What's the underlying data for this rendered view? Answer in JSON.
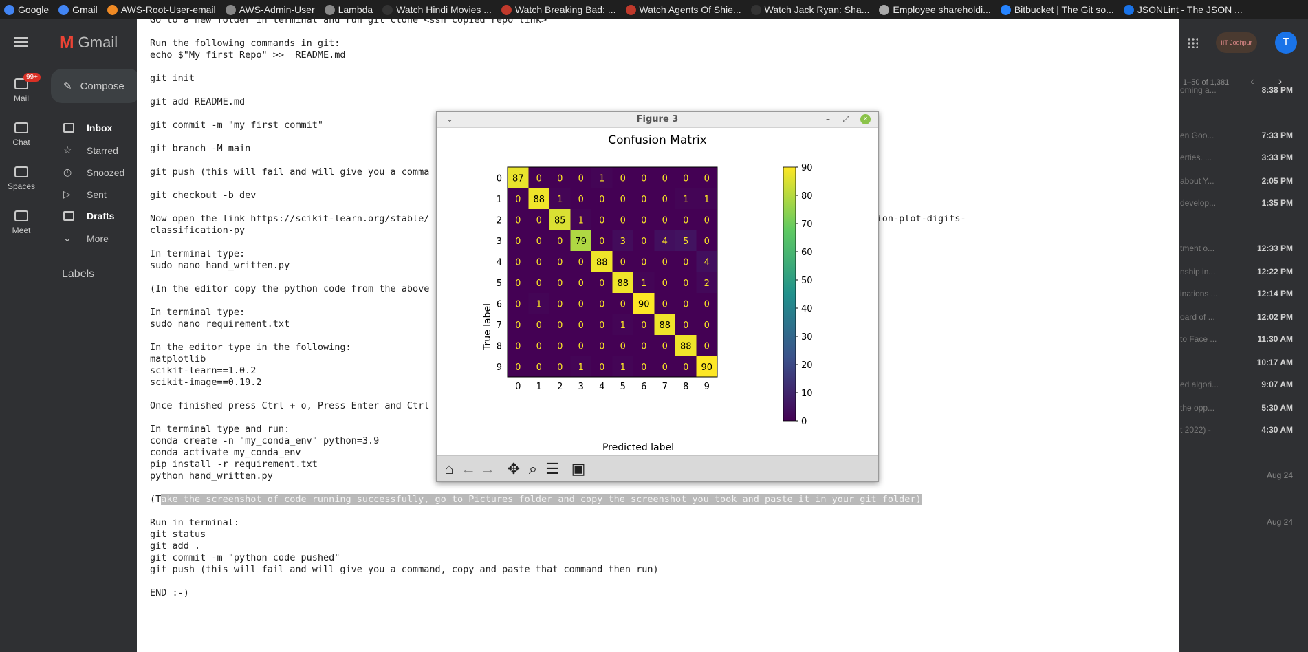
{
  "bookmarks": [
    {
      "label": "Google",
      "icon": "google-icon",
      "color": "#4285f4"
    },
    {
      "label": "Gmail",
      "icon": "google-icon",
      "color": "#4285f4"
    },
    {
      "label": "AWS-Root-User-email",
      "icon": "aws-icon",
      "color": "#f08a24"
    },
    {
      "label": "AWS-Admin-User",
      "icon": "globe-icon",
      "color": "#888888"
    },
    {
      "label": "Lambda",
      "icon": "folder-icon",
      "color": "#888888"
    },
    {
      "label": "Watch Hindi Movies ...",
      "icon": "site-icon",
      "color": "#333333"
    },
    {
      "label": "Watch Breaking Bad: ...",
      "icon": "site-icon",
      "color": "#c0392b"
    },
    {
      "label": "Watch Agents Of Shie...",
      "icon": "site-icon",
      "color": "#c0392b"
    },
    {
      "label": "Watch Jack Ryan: Sha...",
      "icon": "site-icon",
      "color": "#333333"
    },
    {
      "label": "Employee shareholdi...",
      "icon": "site-icon",
      "color": "#aaaaaa"
    },
    {
      "label": "Bitbucket | The Git so...",
      "icon": "bitbucket-icon",
      "color": "#2684ff"
    },
    {
      "label": "JSONLint - The JSON ...",
      "icon": "json-icon",
      "color": "#1a73e8"
    }
  ],
  "gmail": {
    "app_name": "Gmail",
    "compose": "Compose",
    "mail_badge": "99+",
    "rail": [
      "Mail",
      "Chat",
      "Spaces",
      "Meet"
    ],
    "nav": [
      "Inbox",
      "Starred",
      "Snoozed",
      "Sent",
      "Drafts",
      "More"
    ],
    "labels_heading": "Labels",
    "pager": "1–50 of 1,381",
    "avatar_letter": "T",
    "org_badge": "IIT Jodhpur",
    "rows": [
      {
        "snippet": "oming a...",
        "time": "8:38 PM",
        "bold": true
      },
      {
        "snippet": "en Goo...",
        "time": "7:33 PM",
        "bold": true
      },
      {
        "snippet": "erties. ...",
        "time": "3:33 PM",
        "bold": true
      },
      {
        "snippet": "about Y...",
        "time": "2:05 PM",
        "bold": true
      },
      {
        "snippet": "develop...",
        "time": "1:35 PM",
        "bold": true
      },
      {
        "snippet": "tment o...",
        "time": "12:33 PM",
        "bold": true
      },
      {
        "snippet": "nship in...",
        "time": "12:22 PM",
        "bold": true
      },
      {
        "snippet": "inations ...",
        "time": "12:14 PM",
        "bold": true
      },
      {
        "snippet": "oard of ...",
        "time": "12:02 PM",
        "bold": true
      },
      {
        "snippet": "to Face ...",
        "time": "11:30 AM",
        "bold": true
      },
      {
        "snippet": "",
        "time": "10:17 AM",
        "bold": true
      },
      {
        "snippet": "ed algori...",
        "time": "9:07 AM",
        "bold": true
      },
      {
        "snippet": "the opp...",
        "time": "5:30 AM",
        "bold": true
      },
      {
        "snippet": "t 2022) -",
        "time": "4:30 AM",
        "bold": true
      },
      {
        "snippet": "",
        "time": "Aug 24",
        "bold": false
      },
      {
        "snippet": "",
        "time": "Aug 24",
        "bold": false
      }
    ]
  },
  "document": {
    "lines_before": [
      "Go to a new folder in terminal and run git clone <ssh copied repo link>",
      "",
      "Run the following commands in git:",
      "echo $\"My first Repo\" >>  README.md",
      "",
      "git init",
      "",
      "git add README.md",
      "",
      "git commit -m \"my first commit\"",
      "",
      "git branch -M main",
      "",
      "git push (this will fail and will give you a comma",
      "",
      "git checkout -b dev",
      "",
      "Now open the link https://scikit-learn.org/stable/                                                             xamples-classification-plot-digits-",
      "classification-py",
      "",
      "In terminal type:",
      "sudo nano hand_written.py",
      "",
      "(In the editor copy the python code from the above                                                           l + x)",
      "",
      "In terminal type:",
      "sudo nano requirement.txt",
      "",
      "In the editor type in the following:",
      "matplotlib",
      "scikit-learn==1.0.2",
      "scikit-image==0.19.2",
      "",
      "Once finished press Ctrl + o, Press Enter and Ctrl",
      "",
      "In terminal type and run:",
      "conda create -n \"my_conda_env\" python=3.9",
      "conda activate my_conda_env",
      "pip install -r requirement.txt",
      "python hand_written.py",
      ""
    ],
    "highlight_prefix": "(T",
    "highlight_text": "ake the screenshot of code running successfully, go to Pictures folder and copy the screenshot you took and paste it in your git folder)",
    "lines_after": [
      "",
      "Run in terminal:",
      "git status",
      "git add .",
      "git commit -m \"python code pushed\"",
      "git push (this will fail and will give you a command, copy and paste that command then run)",
      "",
      "END :-)"
    ]
  },
  "figure": {
    "window_title": "Figure 3",
    "toolbar": [
      "home-icon",
      "back-arrow-icon",
      "forward-arrow-icon",
      "pan-icon",
      "zoom-icon",
      "configure-icon",
      "save-icon"
    ]
  },
  "chart_data": {
    "type": "heatmap",
    "title": "Confusion Matrix",
    "xlabel": "Predicted label",
    "ylabel": "True label",
    "x_categories": [
      "0",
      "1",
      "2",
      "3",
      "4",
      "5",
      "6",
      "7",
      "8",
      "9"
    ],
    "y_categories": [
      "0",
      "1",
      "2",
      "3",
      "4",
      "5",
      "6",
      "7",
      "8",
      "9"
    ],
    "colormap": "viridis",
    "colorbar_range": [
      0,
      90
    ],
    "colorbar_ticks": [
      0,
      10,
      20,
      30,
      40,
      50,
      60,
      70,
      80,
      90
    ],
    "matrix": [
      [
        87,
        0,
        0,
        0,
        1,
        0,
        0,
        0,
        0,
        0
      ],
      [
        0,
        88,
        1,
        0,
        0,
        0,
        0,
        0,
        1,
        1
      ],
      [
        0,
        0,
        85,
        1,
        0,
        0,
        0,
        0,
        0,
        0
      ],
      [
        0,
        0,
        0,
        79,
        0,
        3,
        0,
        4,
        5,
        0
      ],
      [
        0,
        0,
        0,
        0,
        88,
        0,
        0,
        0,
        0,
        4
      ],
      [
        0,
        0,
        0,
        0,
        0,
        88,
        1,
        0,
        0,
        2
      ],
      [
        0,
        1,
        0,
        0,
        0,
        0,
        90,
        0,
        0,
        0
      ],
      [
        0,
        0,
        0,
        0,
        0,
        1,
        0,
        88,
        0,
        0
      ],
      [
        0,
        0,
        0,
        0,
        0,
        0,
        0,
        0,
        88,
        0
      ],
      [
        0,
        0,
        0,
        1,
        0,
        1,
        0,
        0,
        0,
        90
      ]
    ]
  }
}
